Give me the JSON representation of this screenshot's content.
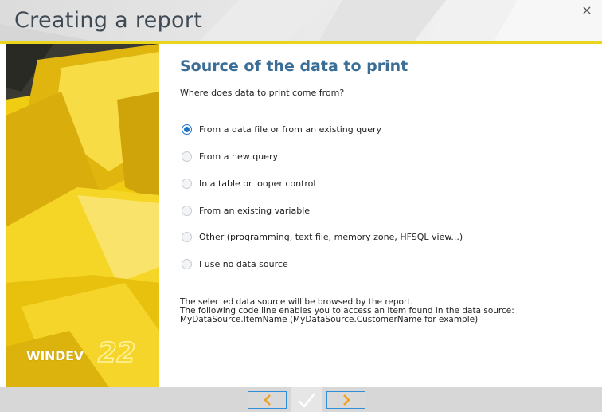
{
  "window": {
    "title": "Creating a report",
    "close_glyph": "×"
  },
  "logo": {
    "brand": "WINDEV",
    "version": "22"
  },
  "page": {
    "section_title": "Source of the data to print",
    "question": "Where does data to print come from?",
    "options": [
      {
        "label": "From a data file or from an existing query",
        "checked": true
      },
      {
        "label": "From a new query",
        "checked": false
      },
      {
        "label": "In a table or looper control",
        "checked": false
      },
      {
        "label": "From an existing variable",
        "checked": false
      },
      {
        "label": "Other (programming, text file, memory zone, HFSQL view...)",
        "checked": false
      },
      {
        "label": "I use no data source",
        "checked": false
      }
    ],
    "note_lines": [
      "The selected data source will be browsed by the report.",
      "The following code line enables you to access an item found in the data source:",
      "MyDataSource.ItemName (MyDataSource.CustomerName for example)"
    ]
  },
  "footer": {
    "back_icon": "chevron-left-icon",
    "finish_icon": "checkmark-icon",
    "next_icon": "chevron-right-icon"
  },
  "colors": {
    "accent_yellow": "#f3d21a",
    "title_blue": "#3a6e96",
    "radio_blue": "#1a73c6",
    "nav_orange": "#f0a020",
    "nav_border": "#2f8fd8"
  }
}
